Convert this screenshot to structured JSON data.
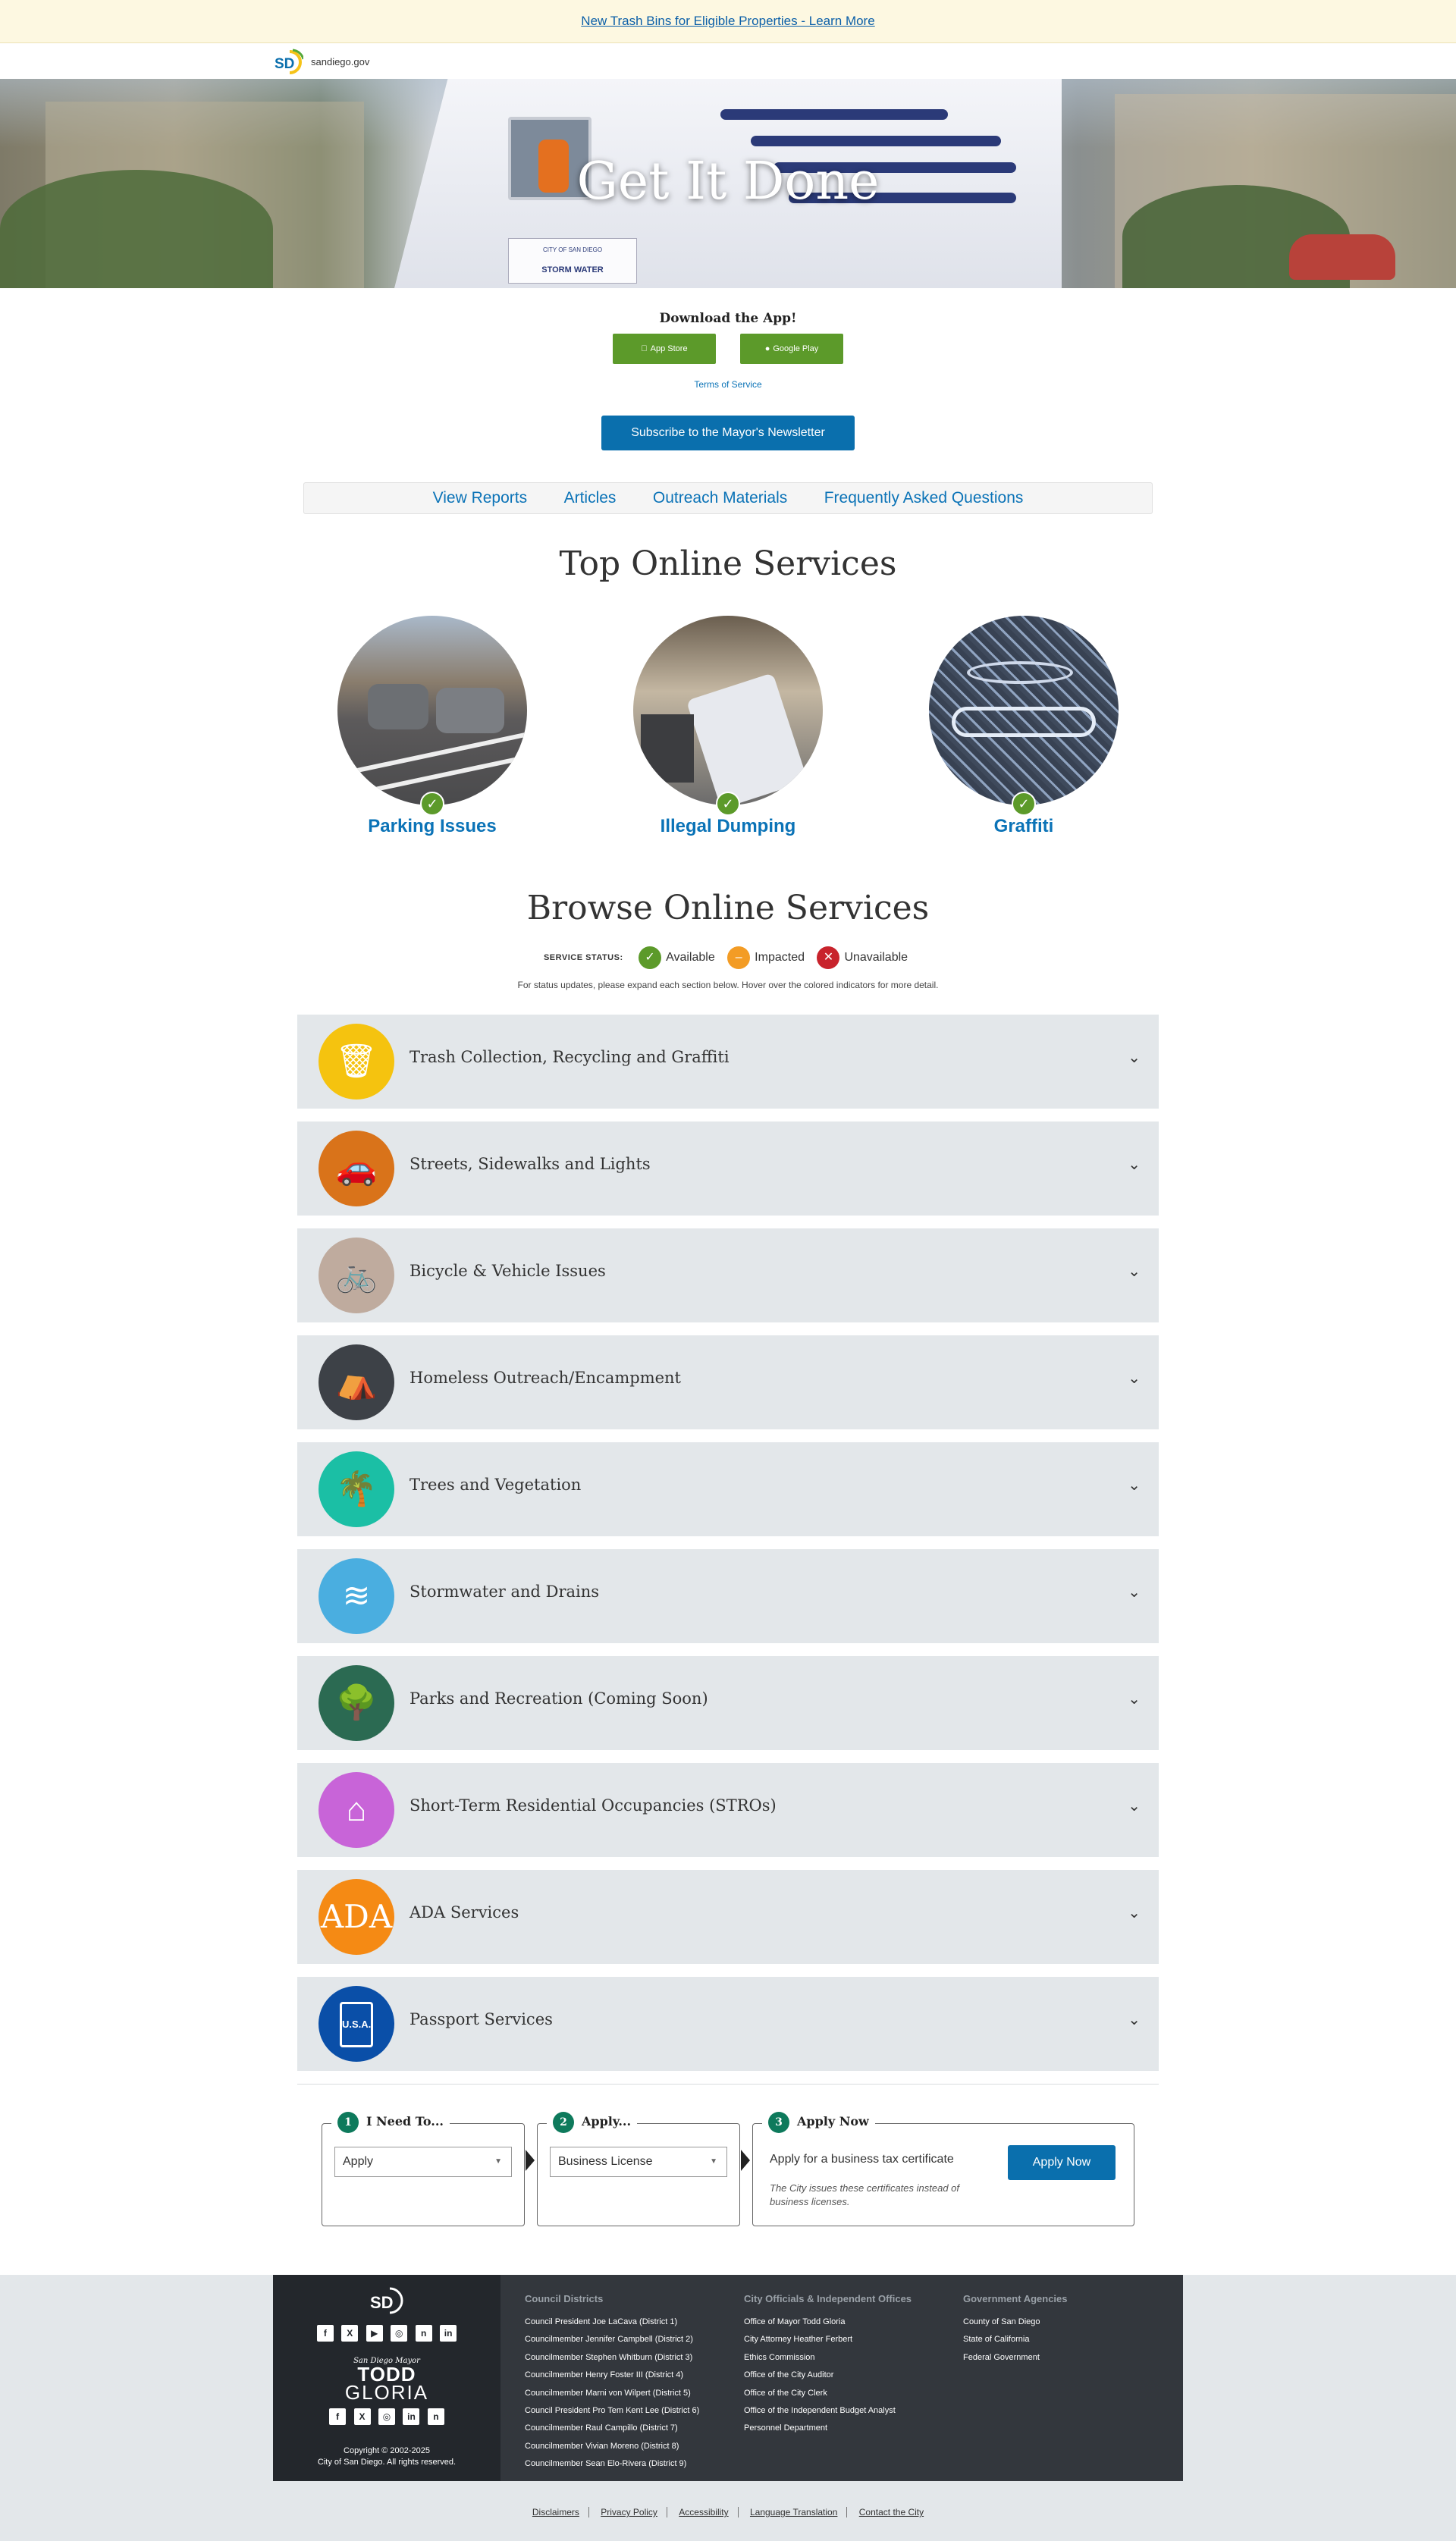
{
  "alert": {
    "text": "New Trash Bins for Eligible Properties - Learn More"
  },
  "site": {
    "logo_text": "SD",
    "domain": "sandiego.gov"
  },
  "hero": {
    "title": "Get It Done",
    "truck_text_1": "CITY OF SAN DIEGO",
    "truck_text_2": "STORM WATER"
  },
  "app": {
    "heading": "Download the App!",
    "app_store": "App Store",
    "google_play": "Google Play",
    "terms": "Terms of Service",
    "newsletter": "Subscribe to the Mayor's Newsletter"
  },
  "subnav": [
    "View Reports",
    "Articles",
    "Outreach Materials",
    "Frequently Asked Questions"
  ],
  "top_services": {
    "title": "Top Online Services",
    "items": [
      {
        "label": "Parking Issues",
        "status": "available"
      },
      {
        "label": "Illegal Dumping",
        "status": "available"
      },
      {
        "label": "Graffiti",
        "status": "available"
      }
    ]
  },
  "browse": {
    "title": "Browse Online Services",
    "status_label": "SERVICE STATUS:",
    "statuses": [
      {
        "label": "Available",
        "color": "#5c9a2a",
        "glyph": "✓"
      },
      {
        "label": "Impacted",
        "color": "#f39c25",
        "glyph": "–"
      },
      {
        "label": "Unavailable",
        "color": "#c8232c",
        "glyph": "✕"
      }
    ],
    "note": "For status updates, please expand each section below. Hover over the colored indicators for more detail.",
    "categories": [
      {
        "title": "Trash Collection, Recycling and Graffiti",
        "icon": "trash-icon",
        "color": "#f5c30f"
      },
      {
        "title": "Streets, Sidewalks and Lights",
        "icon": "streets-icon",
        "color": "#d9731a"
      },
      {
        "title": "Bicycle & Vehicle Issues",
        "icon": "bicycle-icon",
        "color": "#bfab9e"
      },
      {
        "title": "Homeless Outreach/Encampment",
        "icon": "tent-icon",
        "color": "#3d4147"
      },
      {
        "title": "Trees and Vegetation",
        "icon": "tree-icon",
        "color": "#1bbfa5"
      },
      {
        "title": "Stormwater and Drains",
        "icon": "water-icon",
        "color": "#4aaee0"
      },
      {
        "title": "Parks and Recreation (Coming Soon)",
        "icon": "park-icon",
        "color": "#2b6a52"
      },
      {
        "title": "Short-Term Residential Occupancies (STROs)",
        "icon": "house-icon",
        "color": "#c864d8"
      },
      {
        "title": "ADA Services",
        "icon": "ada-icon",
        "color": "#f58a14"
      },
      {
        "title": "Passport Services",
        "icon": "passport-icon",
        "color": "#0a4fa8"
      }
    ],
    "ada_text": "ADA",
    "passport_text": "U.S.A."
  },
  "wizard": {
    "step1": {
      "num": "1",
      "label": "I Need To...",
      "value": "Apply"
    },
    "step2": {
      "num": "2",
      "label": "Apply...",
      "value": "Business License"
    },
    "step3": {
      "num": "3",
      "label": "Apply Now",
      "desc": "Apply for a business tax certificate",
      "note": "The City issues these certificates instead of business licenses.",
      "button": "Apply Now"
    }
  },
  "footer": {
    "logo_text": "SD",
    "social_city": [
      "f",
      "X",
      "▶",
      "◎",
      "n",
      "in"
    ],
    "mayor_small": "San Diego Mayor",
    "mayor_name_1": "TODD",
    "mayor_name_2": "GLORIA",
    "social_mayor": [
      "f",
      "X",
      "◎",
      "in",
      "n"
    ],
    "copyright_1": "Copyright © 2002-2025",
    "copyright_2": "City of San Diego. All rights reserved.",
    "col1": {
      "title": "Council Districts",
      "links": [
        "Council President Joe LaCava (District 1)",
        "Councilmember Jennifer Campbell (District 2)",
        "Councilmember Stephen Whitburn (District 3)",
        "Councilmember Henry Foster III (District 4)",
        "Councilmember Marni von Wilpert (District 5)",
        "Council President Pro Tem Kent Lee (District 6)",
        "Councilmember Raul Campillo (District 7)",
        "Councilmember Vivian Moreno (District 8)",
        "Councilmember Sean Elo-Rivera (District 9)"
      ]
    },
    "col2": {
      "title": "City Officials & Independent Offices",
      "links": [
        "Office of Mayor Todd Gloria",
        "City Attorney Heather Ferbert",
        "Ethics Commission",
        "Office of the City Auditor",
        "Office of the City Clerk",
        "Office of the Independent Budget Analyst",
        "Personnel Department"
      ]
    },
    "col3": {
      "title": "Government Agencies",
      "links": [
        "County of San Diego",
        "State of California",
        "Federal Government"
      ]
    },
    "bottom_links": [
      "Disclaimers",
      "Privacy Policy",
      "Accessibility",
      "Language Translation",
      "Contact the City"
    ]
  }
}
